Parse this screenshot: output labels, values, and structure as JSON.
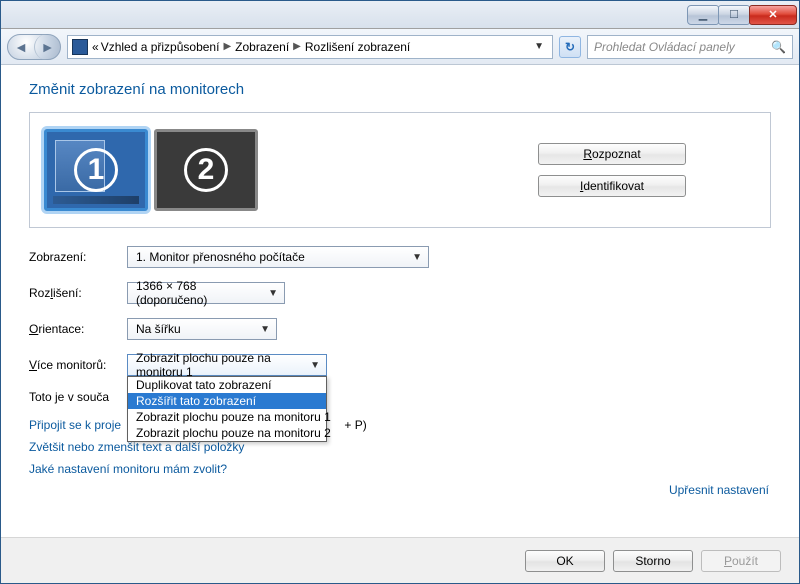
{
  "breadcrumb": {
    "prefix": "«",
    "levels": [
      "Vzhled a přizpůsobení",
      "Zobrazení",
      "Rozlišení zobrazení"
    ]
  },
  "search": {
    "placeholder": "Prohledat Ovládací panely"
  },
  "page": {
    "title": "Změnit zobrazení na monitorech"
  },
  "buttons": {
    "rozpoznat": "Rozpoznat",
    "identifikovat": "Identifikovat",
    "rozpoznat_u": "R",
    "identifikovat_u": "I"
  },
  "monitors": {
    "num1": "1",
    "num2": "2"
  },
  "labels": {
    "zobrazeni": "Zobrazení:",
    "rozliseni": "Rozlišení:",
    "orientace": "Orientace:",
    "vice_monitoru": "Více monitorů:",
    "rozliseni_u": "l",
    "orientace_u": "O",
    "vice_u": "V"
  },
  "selects": {
    "zobrazeni": "1. Monitor přenosného počítače",
    "rozliseni": "1366 × 768 (doporučeno)",
    "orientace": "Na šířku",
    "vice_monitoru": "Zobrazit plochu pouze na monitoru 1"
  },
  "dropdown_items": [
    "Duplikovat tato zobrazení",
    "Rozšířit tato zobrazení",
    "Zobrazit plochu pouze na monitoru 1",
    "Zobrazit plochu pouze na monitoru 2"
  ],
  "dropdown_selected_index": 1,
  "info_line": "Toto je v souča",
  "info_tail": " + P)",
  "links": {
    "pripojit": "Připojit se k proje",
    "zvetsit": "Zvětšit nebo zmenšit text a další položky",
    "jake": "Jaké nastavení monitoru mám zvolit?",
    "upresnit": "Upřesnit nastavení"
  },
  "footer": {
    "ok": "OK",
    "storno": "Storno",
    "pouzit": "Použít",
    "pouzit_u": "P"
  }
}
